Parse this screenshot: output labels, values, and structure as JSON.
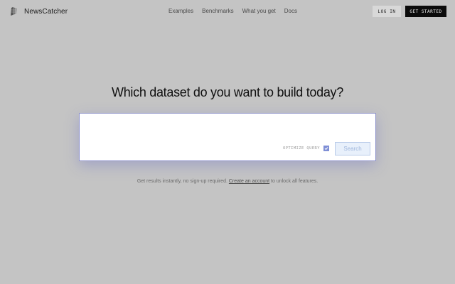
{
  "header": {
    "brand_name": "NewsCatcher",
    "nav": [
      "Examples",
      "Benchmarks",
      "What you get",
      "Docs"
    ],
    "login_label": "LOG IN",
    "get_started_label": "GET STARTED"
  },
  "hero": {
    "title": "Which dataset do you want to build today?"
  },
  "search": {
    "placeholder": "",
    "value": "",
    "optimize_label": "OPTIMIZE QUERY",
    "optimize_checked": true,
    "button_label": "Search"
  },
  "note": {
    "prefix": "Get results instantly, no sign-up required.",
    "link": "Create an account",
    "suffix": "to unlock all features."
  },
  "colors": {
    "background": "#c4c4c4",
    "accent": "#7f8fd6",
    "primary_button": "#0b0b0b"
  },
  "icons": {
    "brand": "newscatcher-logo-icon",
    "checkbox": "checkmark-icon"
  }
}
